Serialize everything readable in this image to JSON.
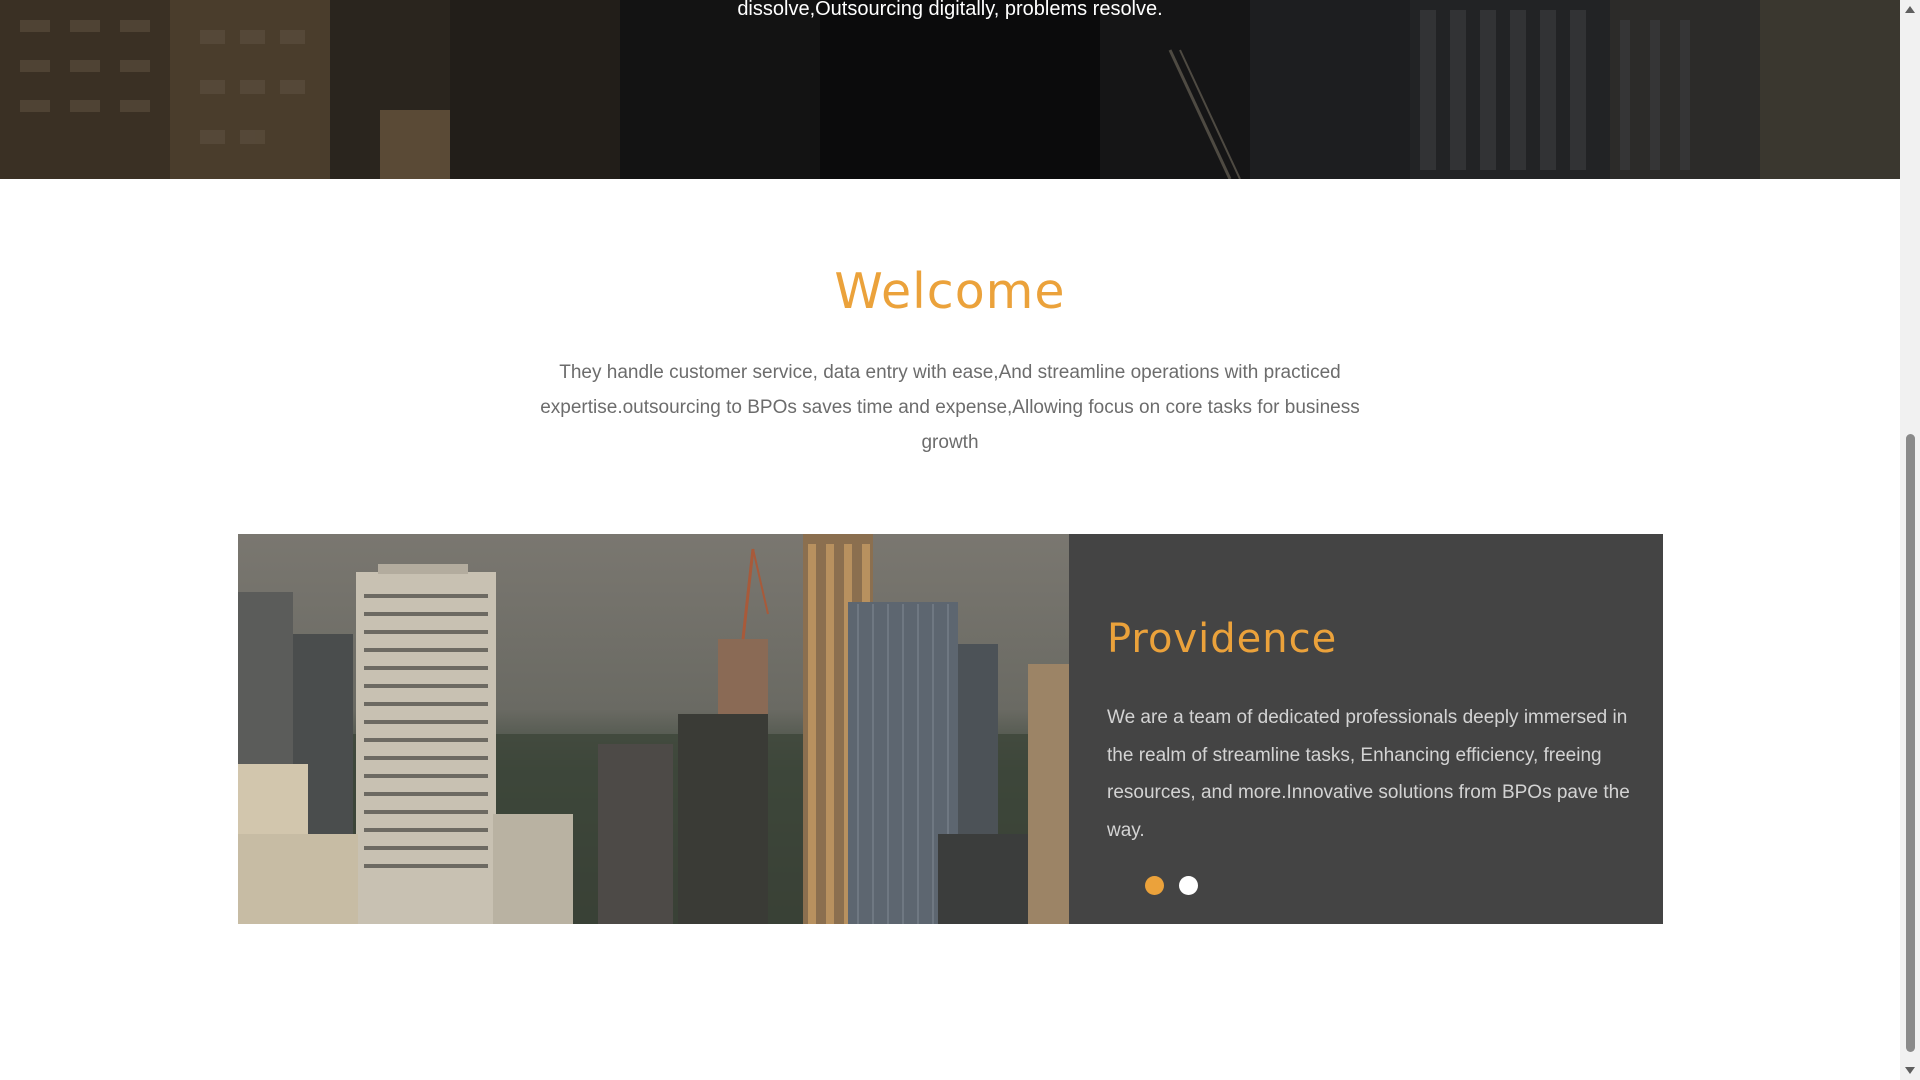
{
  "hero": {
    "text": "dissolve,Outsourcing digitally, problems resolve."
  },
  "welcome": {
    "title": "Welcome",
    "body": "They handle customer service, data entry with ease,And streamline operations with practiced expertise.outsourcing to BPOs saves time and expense,Allowing focus on core tasks for business growth"
  },
  "slider": {
    "title": "Providence",
    "body": "We are a team of dedicated professionals deeply immersed in the realm of streamline tasks, Enhancing efficiency, freeing resources, and more.Innovative solutions from BPOs pave the way.",
    "active_slide": 1,
    "slide_count": 2
  },
  "colors": {
    "accent": "#eba23b",
    "panel": "#444444",
    "body_text": "#6c6c6c"
  }
}
